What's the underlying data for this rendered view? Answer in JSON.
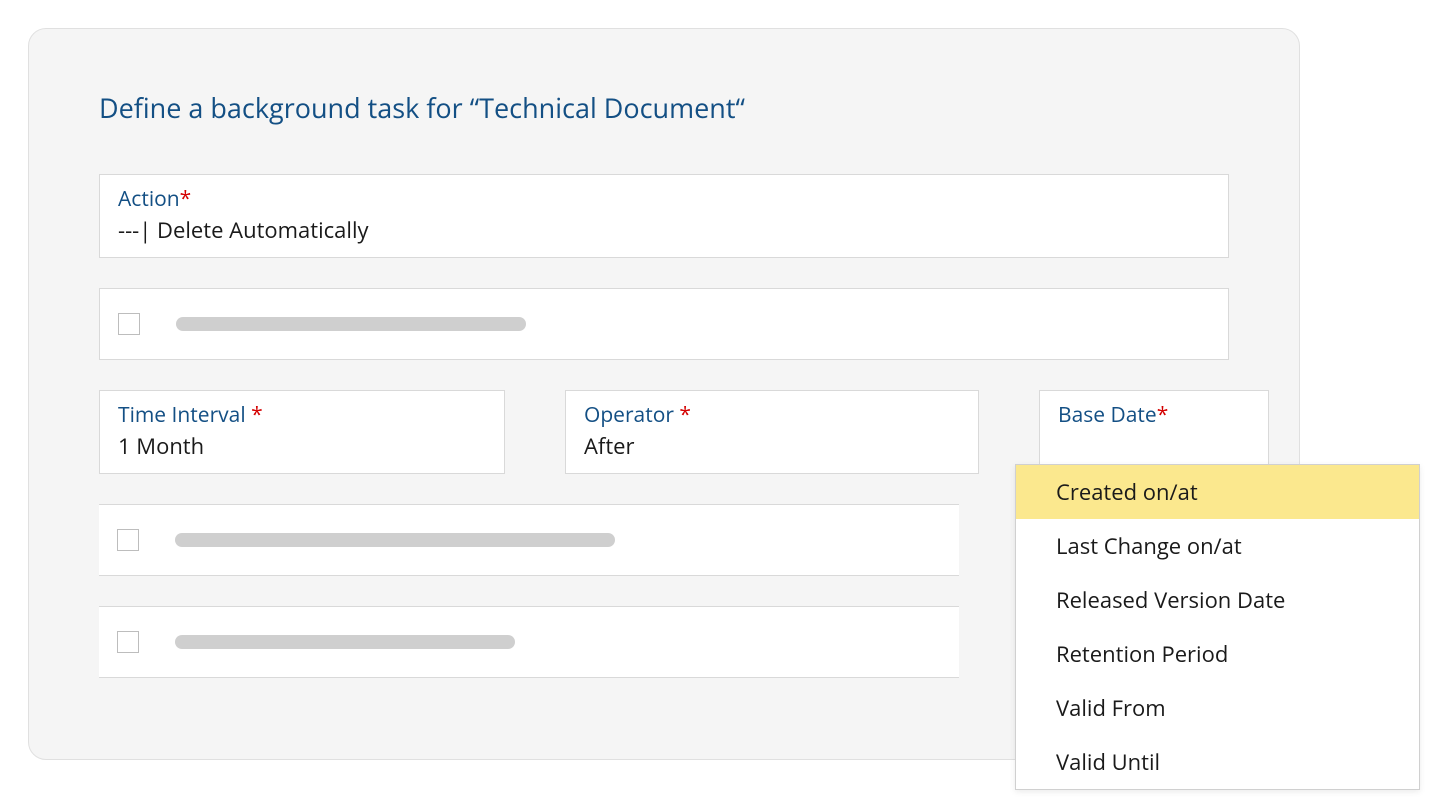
{
  "page": {
    "title": "Define a background task for “Technical Document“"
  },
  "fields": {
    "action": {
      "label": "Action",
      "required": "*",
      "value": "---| Delete Automatically"
    },
    "time_interval": {
      "label": "Time Interval ",
      "required": "*",
      "value": "1 Month"
    },
    "operator": {
      "label": "Operator ",
      "required": "*",
      "value": "After"
    },
    "base_date": {
      "label": "Base Date",
      "required": "*"
    }
  },
  "dropdown": {
    "items": [
      {
        "label": "Created on/at",
        "selected": true
      },
      {
        "label": "Last Change on/at",
        "selected": false
      },
      {
        "label": "Released Version Date",
        "selected": false
      },
      {
        "label": "Retention Period",
        "selected": false
      },
      {
        "label": "Valid From",
        "selected": false
      },
      {
        "label": "Valid Until",
        "selected": false
      }
    ]
  }
}
